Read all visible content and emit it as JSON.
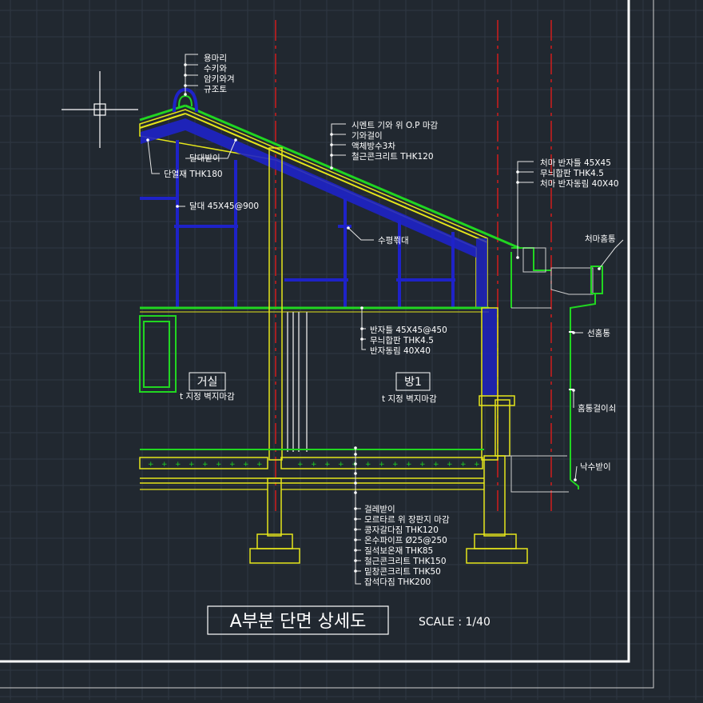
{
  "colors": {
    "background": "#212830",
    "grid": "#2f3843",
    "border": "#ffffff",
    "structure_yellow": "#e5e51a",
    "insulation_blue": "#1e22c8",
    "finish_green": "#21d621",
    "centerline_red": "#d11c1c",
    "leader_white": "#e6e6e6"
  },
  "labels": {
    "ridge": [
      "용마리",
      "수키와",
      "암키와겨",
      "규조토"
    ],
    "roof": [
      "시멘트 기와 위 O.P 마감",
      "기와걸이",
      "액체방수3차",
      "철근콘크리트 THK120"
    ],
    "eave_top": [
      "처마 반자틀 45X45",
      "무늬합판 THK4.5",
      "처마 반자동림 40X40"
    ],
    "eave_gutter": "처마홈통",
    "insulation_top": "달대받이",
    "insulation": "단열재 THK180",
    "hanger": "달대 45X45@900",
    "beam": "수평쬒대",
    "ceiling": [
      "반자틀 45X45@450",
      "무늬합판 THK4.5",
      "반자동림 40X40"
    ],
    "downpipe": "선홈통",
    "downpipe_bracket": "홈통걸이쇠",
    "drip": "낙수받이",
    "room_living": "거실",
    "room_living_finish": "t 지정 벽지마감",
    "room_bed": "방1",
    "room_bed_finish": "t 지정 벽지마감",
    "floor": [
      "걸레받이",
      "모르타르 위 장판지 마감",
      "콩자갈다짐 THK120",
      "온수파이프 Ø25@250",
      "질석보온재 THK85",
      "철근콘크리트 THK150",
      "밑창콘크리트 THK50",
      "잡석다짐 THK200"
    ]
  },
  "title": "A부분 단면 상세도",
  "scale": "SCALE : 1/40"
}
